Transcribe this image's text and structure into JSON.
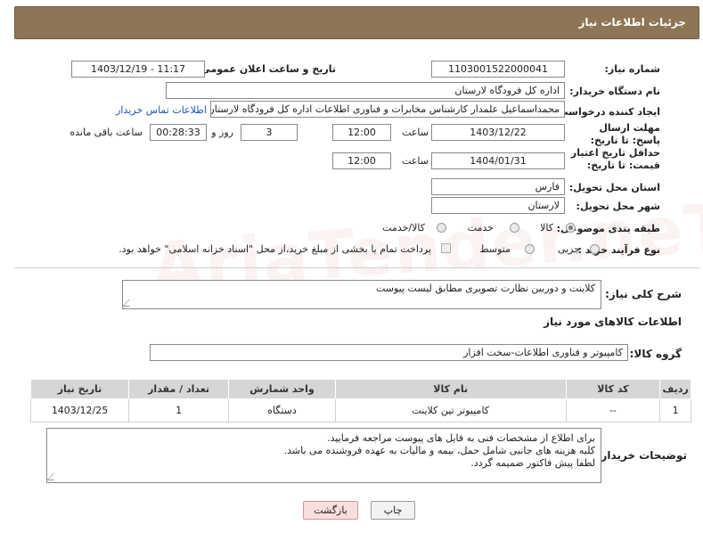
{
  "header": {
    "title": "جزئیات اطلاعات نیاز"
  },
  "need_number": {
    "label": "شماره نیاز:",
    "value": "1103001522000041"
  },
  "announce": {
    "label": "تاریخ و ساعت اعلان عمومی:",
    "value": "1403/12/19 - 11:17"
  },
  "buyer_org": {
    "label": "نام دستگاه خریدار:",
    "value": "اداره کل فرودگاه لارستان"
  },
  "creator": {
    "label": "ایجاد کننده درخواست:",
    "value": "محمداسماعیل علمدار کارشناس مخابرات و فناوری اطلاعات اداره کل فرودگاه لارستان",
    "contact_link": "اطلاعات تماس خریدار"
  },
  "reply_deadline": {
    "label": "مهلت ارسال پاسخ: تا تاریخ:",
    "date": "1403/12/22",
    "time_label": "ساعت",
    "time": "12:00",
    "days": "3",
    "days_label": "روز و",
    "remaining": "00:28:33",
    "remaining_label": "ساعت باقی مانده"
  },
  "price_validity": {
    "label": "حداقل تاریخ اعتبار قیمت: تا تاریخ:",
    "date": "1404/01/31",
    "time_label": "ساعت",
    "time": "12:00"
  },
  "province": {
    "label": "استان محل تحویل:",
    "value": "فارس"
  },
  "city": {
    "label": "شهر محل تحویل:",
    "value": "لارستان"
  },
  "category": {
    "label": "طبقه بندی موضوعی:",
    "options": [
      "کالا",
      "خدمت",
      "کالا/خدمت"
    ],
    "selected": "کالا"
  },
  "process": {
    "label": "نوع فرآیند خرید :",
    "options": [
      "جزیی",
      "متوسط"
    ],
    "note": "پرداخت تمام یا بخشی از مبلغ خرید،از محل \"اسناد خزانه اسلامی\" خواهد بود."
  },
  "description": {
    "label": "شرح کلی نیاز:",
    "value": "کلاینت و دوربین نظارت تصویری مطابق لیست پیوست"
  },
  "goods_section": {
    "title": "اطلاعات کالاهای مورد نیاز"
  },
  "goods_group": {
    "label": "گروه کالا:",
    "value": "کامپیوتر و فناوری اطلاعات-سخت افزار"
  },
  "table": {
    "headers": [
      "ردیف",
      "کد کالا",
      "نام کالا",
      "واحد شمارش",
      "تعداد / مقدار",
      "تاریخ نیاز"
    ],
    "rows": [
      [
        "1",
        "--",
        "کامپیوتر تین کلاینت",
        "دستگاه",
        "1",
        "1403/12/25"
      ]
    ]
  },
  "buyer_notes": {
    "label": "توضیحات خریدار:",
    "lines": [
      "برای اطلاع از مشخصات فنی به فایل های پیوست مراجعه فرمایید.",
      "کلیه هزینه های جانبی شامل حمل، بیمه و مالیات به عهده فروشنده می باشد.",
      "لطفا پیش فاکتور ضمیمه گردد."
    ]
  },
  "buttons": {
    "print": "چاپ",
    "back": "بازگشت"
  },
  "colors": {
    "header_bg": "#8d7556",
    "link": "#1a55b8",
    "back_button_bg": "#f9dede"
  }
}
